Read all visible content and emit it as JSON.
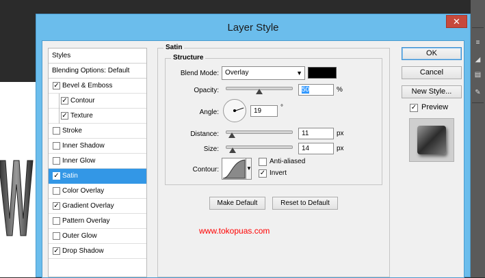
{
  "dialog": {
    "title": "Layer Style",
    "close_glyph": "✕"
  },
  "styles_list": {
    "header": "Styles",
    "blending_options": "Blending Options: Default",
    "items": [
      {
        "label": "Bevel & Emboss",
        "checked": true,
        "sub": false,
        "selected": false
      },
      {
        "label": "Contour",
        "checked": true,
        "sub": true,
        "selected": false
      },
      {
        "label": "Texture",
        "checked": true,
        "sub": true,
        "selected": false
      },
      {
        "label": "Stroke",
        "checked": false,
        "sub": false,
        "selected": false
      },
      {
        "label": "Inner Shadow",
        "checked": false,
        "sub": false,
        "selected": false
      },
      {
        "label": "Inner Glow",
        "checked": false,
        "sub": false,
        "selected": false
      },
      {
        "label": "Satin",
        "checked": true,
        "sub": false,
        "selected": true
      },
      {
        "label": "Color Overlay",
        "checked": false,
        "sub": false,
        "selected": false
      },
      {
        "label": "Gradient Overlay",
        "checked": true,
        "sub": false,
        "selected": false
      },
      {
        "label": "Pattern Overlay",
        "checked": false,
        "sub": false,
        "selected": false
      },
      {
        "label": "Outer Glow",
        "checked": false,
        "sub": false,
        "selected": false
      },
      {
        "label": "Drop Shadow",
        "checked": true,
        "sub": false,
        "selected": false
      }
    ]
  },
  "satin": {
    "group_title": "Satin",
    "structure_title": "Structure",
    "blend_mode_label": "Blend Mode:",
    "blend_mode_value": "Overlay",
    "blend_color": "#000000",
    "opacity_label": "Opacity:",
    "opacity_value": "50",
    "opacity_unit": "%",
    "angle_label": "Angle:",
    "angle_value": "19",
    "angle_unit": "°",
    "distance_label": "Distance:",
    "distance_value": "11",
    "distance_unit": "px",
    "size_label": "Size:",
    "size_value": "14",
    "size_unit": "px",
    "contour_label": "Contour:",
    "anti_aliased_label": "Anti-aliased",
    "anti_aliased_checked": false,
    "invert_label": "Invert",
    "invert_checked": true,
    "make_default_label": "Make Default",
    "reset_default_label": "Reset to Default"
  },
  "watermark": "www.tokopuas.com",
  "actions": {
    "ok_label": "OK",
    "cancel_label": "Cancel",
    "new_style_label": "New Style...",
    "preview_label": "Preview",
    "preview_checked": true
  },
  "colors": {
    "titlebar": "#6bbdec",
    "selection": "#3397e6",
    "close": "#c7493c",
    "watermark": "#ff0000"
  }
}
